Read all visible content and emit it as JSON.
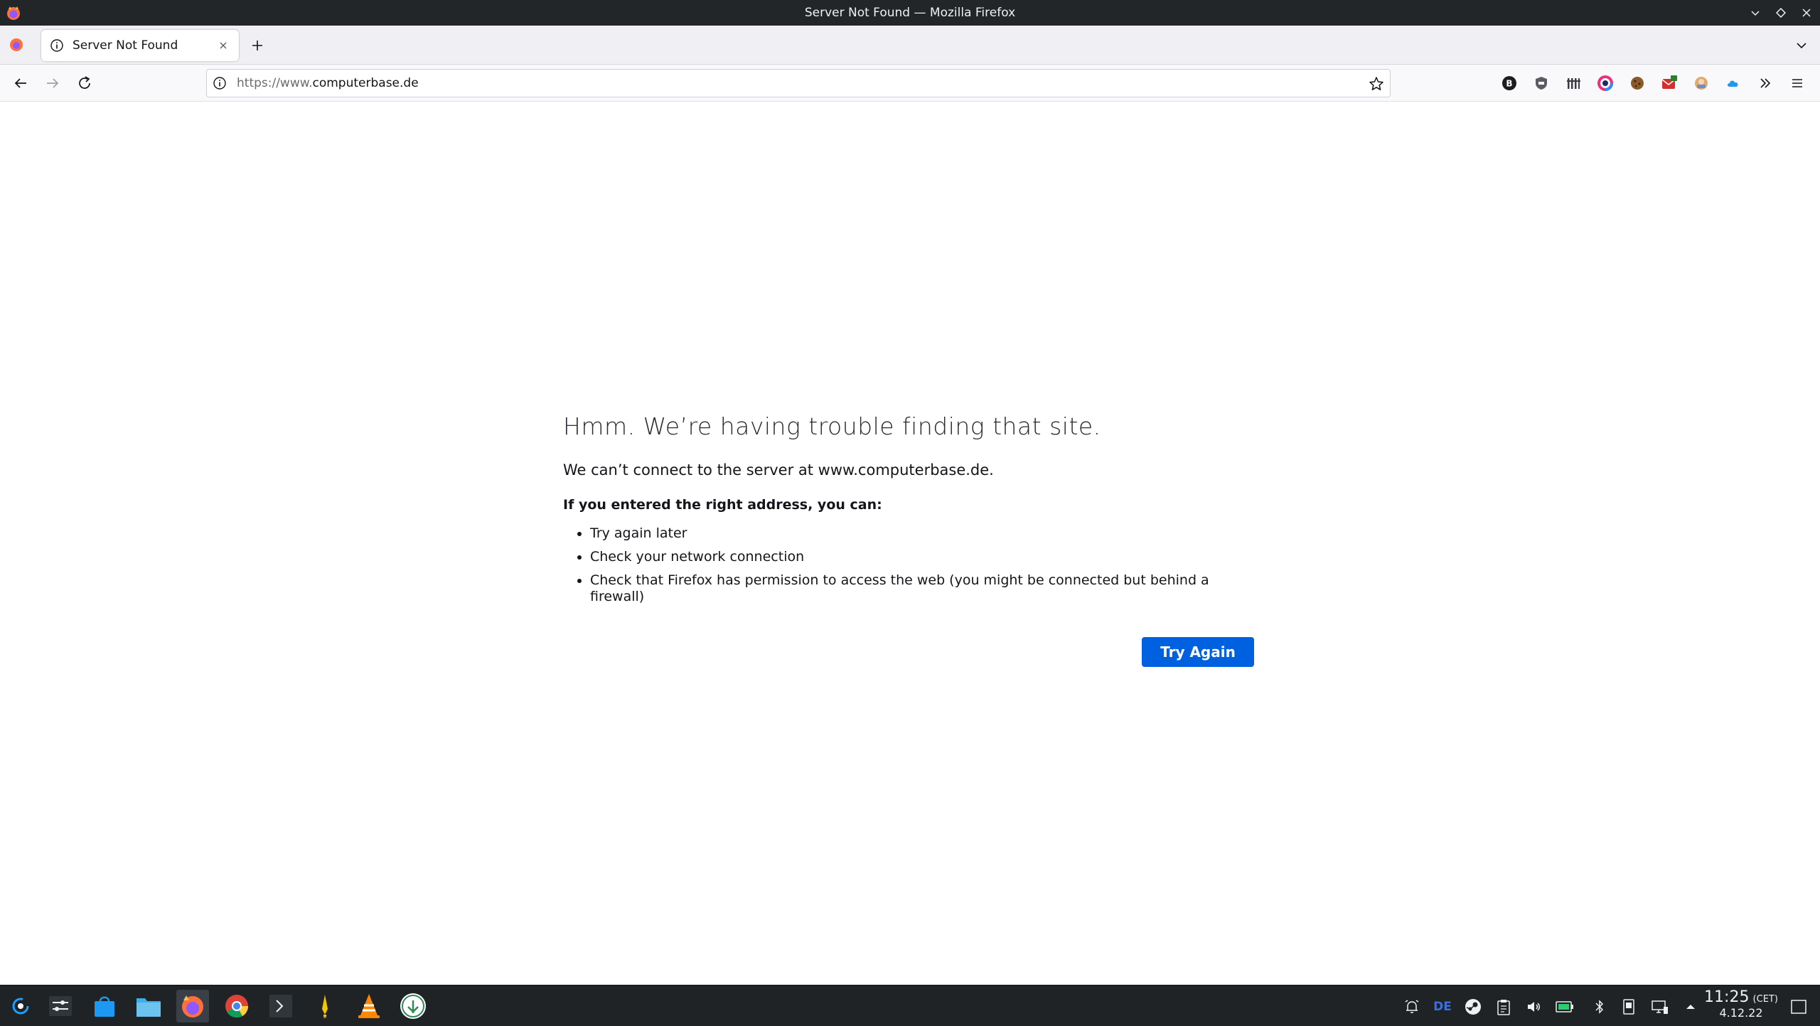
{
  "window": {
    "title": "Server Not Found — Mozilla Firefox"
  },
  "tabs": [
    {
      "label": "Server Not Found"
    }
  ],
  "urlbar": {
    "url_prefix": "https://www.",
    "url_domain": "computerbase.de"
  },
  "error": {
    "title": "Hmm. We’re having trouble finding that site.",
    "description": "We can’t connect to the server at www.computerbase.de.",
    "subtitle": "If you entered the right address, you can:",
    "suggestions": [
      "Try again later",
      "Check your network connection",
      "Check that Firefox has permission to access the web (you might be connected but behind a firewall)"
    ],
    "button_label": "Try Again"
  },
  "tray": {
    "keyboard_layout": "DE",
    "time": "11:25",
    "timezone": "(CET)",
    "date": "4.12.22"
  },
  "colors": {
    "accent": "#0061e0",
    "titlebar": "#232629",
    "taskbar": "#202326"
  }
}
